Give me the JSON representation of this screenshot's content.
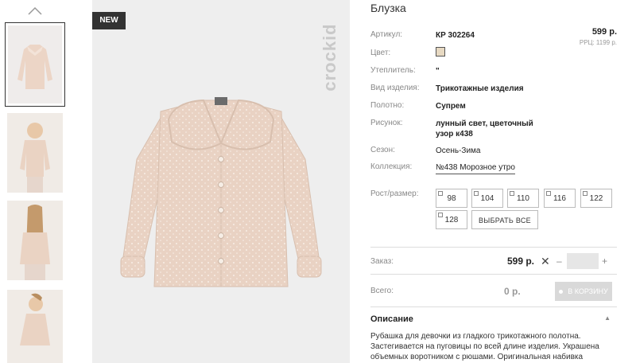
{
  "gallery": {
    "badge": "NEW",
    "brand": "crockid"
  },
  "product": {
    "title": "Блузка",
    "price": "599 р.",
    "rrc": "РРЦ: 1199 р.",
    "attributes": [
      {
        "label": "Артикул:",
        "value": "КР 302264"
      },
      {
        "label": "Цвет:",
        "value": ""
      },
      {
        "label": "Утеплитель:",
        "value": "\""
      },
      {
        "label": "Вид изделия:",
        "value": "Трикотажные изделия"
      },
      {
        "label": "Полотно:",
        "value": "Супрем"
      },
      {
        "label": "Рисунок:",
        "value": "лунный свет, цветочный узор к438"
      },
      {
        "label": "Сезон:",
        "value": "Осень-Зима"
      },
      {
        "label": "Коллекция:",
        "value": "№438 Морозное утро"
      }
    ],
    "swatch_color": "#e7d9c2"
  },
  "sizes": {
    "label": "Рост/размер:",
    "items": [
      "98",
      "104",
      "110",
      "116",
      "122",
      "128"
    ],
    "select_all": "ВЫБРАТЬ ВСЕ"
  },
  "order": {
    "label": "Заказ:",
    "price": "599 р.",
    "remove": "✕",
    "minus": "–",
    "plus": "+",
    "qty": ""
  },
  "total": {
    "label": "Всего:",
    "value": "0 р.",
    "cart_button": "В КОРЗИНУ"
  },
  "description": {
    "heading": "Описание",
    "text": "Рубашка для девочки из гладкого трикотажного полотна. Застегивается на пуговицы по всей длине изделия. Украшена объемных воротником с рюшами. Оригинальная набивка выполнена"
  }
}
